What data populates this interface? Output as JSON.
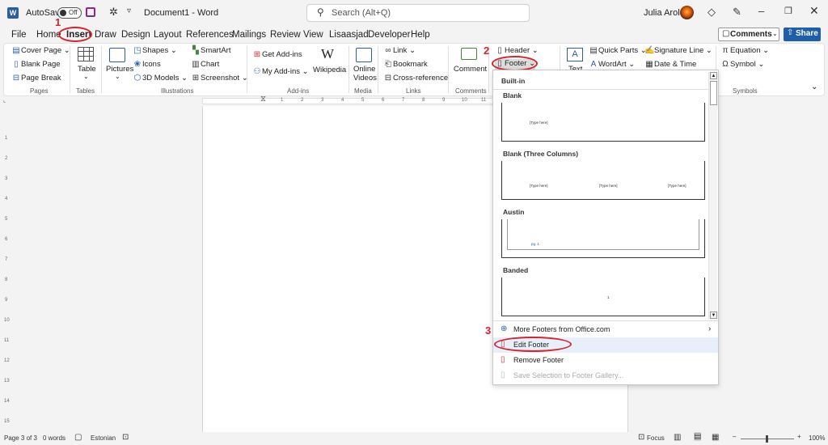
{
  "titlebar": {
    "autosave_label": "AutoSave",
    "autosave_state": "Off",
    "doc_title": "Document1  -  Word",
    "search_placeholder": "Search (Alt+Q)",
    "user_name": "Julia Arold"
  },
  "menu": {
    "tabs": [
      "File",
      "Home",
      "Insert",
      "Draw",
      "Design",
      "Layout",
      "References",
      "Mailings",
      "Review",
      "View",
      "Lisaasjad",
      "Developer",
      "Help"
    ],
    "comments_label": "Comments",
    "share_label": "Share"
  },
  "ribbon": {
    "pages": {
      "cover_page": "Cover Page",
      "blank_page": "Blank Page",
      "page_break": "Page Break",
      "group": "Pages"
    },
    "tables": {
      "table": "Table",
      "group": "Tables"
    },
    "illustrations": {
      "pictures": "Pictures",
      "shapes": "Shapes",
      "icons": "Icons",
      "models": "3D Models",
      "smartart": "SmartArt",
      "chart": "Chart",
      "screenshot": "Screenshot",
      "group": "Illustrations"
    },
    "addins": {
      "get_addins": "Get Add-ins",
      "my_addins": "My Add-ins",
      "wikipedia": "Wikipedia",
      "group": "Add-ins"
    },
    "media": {
      "online_videos_1": "Online",
      "online_videos_2": "Videos",
      "group": "Media"
    },
    "links": {
      "link": "Link",
      "bookmark": "Bookmark",
      "crossref": "Cross-reference",
      "group": "Links"
    },
    "comments": {
      "comment": "Comment",
      "group": "Comments"
    },
    "header_footer": {
      "header": "Header",
      "footer": "Footer"
    },
    "text": {
      "text": "Text",
      "quick_parts": "Quick Parts",
      "wordart": "WordArt",
      "signature_line": "Signature Line",
      "date_time": "Date & Time"
    },
    "symbols": {
      "equation": "Equation",
      "symbol": "Symbol",
      "group": "Symbols"
    }
  },
  "annotations": {
    "step1": "1",
    "step2": "2",
    "step3": "3"
  },
  "dropdown": {
    "section": "Built-in",
    "gallery": [
      {
        "name": "Blank",
        "thumb": "[Type here]"
      },
      {
        "name": "Blank (Three Columns)",
        "thumb": [
          "[Type here]",
          "[Type here]",
          "[Type here]"
        ]
      },
      {
        "name": "Austin",
        "thumb": "pg. 1"
      },
      {
        "name": "Banded",
        "thumb": "1"
      }
    ],
    "items": {
      "more": "More Footers from Office.com",
      "edit": "Edit Footer",
      "remove": "Remove Footer",
      "save": "Save Selection to Footer Gallery..."
    }
  },
  "ruler_numbers": [
    "1",
    "2",
    "3",
    "4",
    "5",
    "6",
    "7",
    "8",
    "9",
    "10",
    "11"
  ],
  "left_ruler_numbers": [
    "1",
    "2",
    "3",
    "4",
    "5",
    "6",
    "7",
    "8",
    "9",
    "10",
    "11",
    "12",
    "13",
    "14",
    "15"
  ],
  "status": {
    "page": "Page 3 of 3",
    "words": "0 words",
    "language": "Estonian",
    "focus": "Focus",
    "zoom": "100%"
  },
  "colors": {
    "accent": "#2b5ca8",
    "annotation_red": "#d6252c",
    "share_bg": "#1f5ea8"
  }
}
